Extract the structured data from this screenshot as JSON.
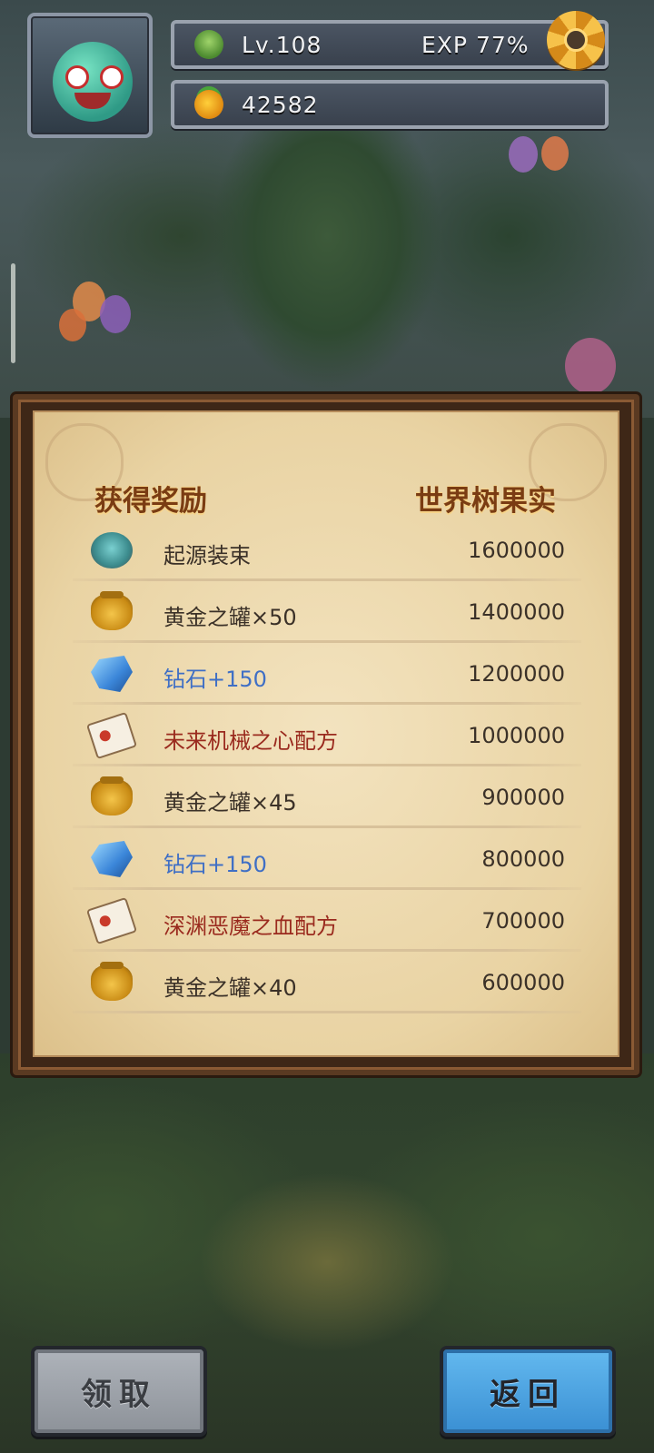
{
  "hud": {
    "level": "Lv.108",
    "exp_label": "EXP 77%",
    "coins": "42582"
  },
  "panel": {
    "header_left": "获得奖励",
    "header_right": "世界树果实",
    "rewards": [
      {
        "name": "起源装束",
        "value": "1600000",
        "icon": "costume-icon",
        "color": "default"
      },
      {
        "name": "黄金之罐×50",
        "value": "1400000",
        "icon": "golden-pot-icon",
        "color": "default"
      },
      {
        "name": "钻石+150",
        "value": "1200000",
        "icon": "diamond-icon",
        "color": "blue"
      },
      {
        "name": "未来机械之心配方",
        "value": "1000000",
        "icon": "recipe-scroll-icon",
        "color": "red"
      },
      {
        "name": "黄金之罐×45",
        "value": "900000",
        "icon": "golden-pot-icon",
        "color": "default"
      },
      {
        "name": "钻石+150",
        "value": "800000",
        "icon": "diamond-icon",
        "color": "blue"
      },
      {
        "name": "深渊恶魔之血配方",
        "value": "700000",
        "icon": "recipe-scroll-icon",
        "color": "red"
      },
      {
        "name": "黄金之罐×40",
        "value": "600000",
        "icon": "golden-pot-icon",
        "color": "default"
      }
    ]
  },
  "buttons": {
    "claim": "领取",
    "back": "返回"
  },
  "colors": {
    "name_blue": "#3f6fc5",
    "name_red": "#9a2a1e",
    "header_brown": "#7a3c13",
    "back_button": "#4aa3e3",
    "claim_button": "#9ea3aa"
  }
}
